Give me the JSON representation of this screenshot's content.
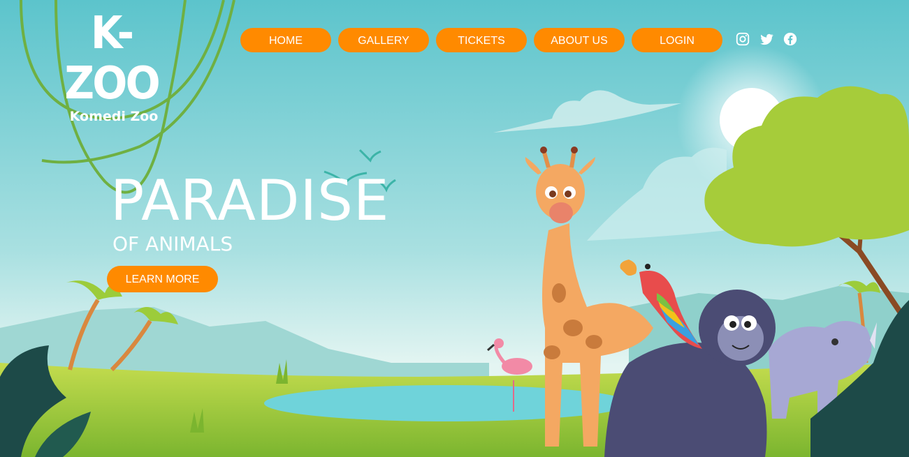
{
  "brand": {
    "name": "K-ZOO",
    "tagline": "Komedi Zoo"
  },
  "nav": {
    "home_label": "HOME",
    "gallery_label": "GALLERY",
    "tickets_label": "TICKETS",
    "about_label": "ABOUT US",
    "login_label": "LOGIN"
  },
  "social": {
    "icons": [
      "instagram-icon",
      "twitter-icon",
      "facebook-icon"
    ]
  },
  "hero": {
    "title": "PARADISE",
    "subtitle": "OF ANIMALS",
    "cta_label": "LEARN MORE"
  },
  "colors": {
    "sky_top": "#5cc4cc",
    "sky_bottom": "#d8f1ef",
    "accent": "#ff8a00",
    "grass": "#9ccc3a",
    "water": "#6fd3da"
  }
}
